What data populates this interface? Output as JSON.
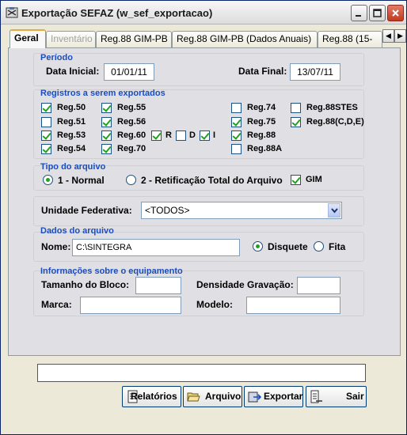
{
  "window": {
    "title": "Exportação SEFAZ (w_sef_exportacao)"
  },
  "tabs": [
    {
      "label": "Geral",
      "state": "active"
    },
    {
      "label": "Inventário",
      "state": "disabled"
    },
    {
      "label": "Reg.88 GIM-PB",
      "state": "normal"
    },
    {
      "label": "Reg.88 GIM-PB (Dados Anuais)",
      "state": "normal"
    },
    {
      "label": "Reg.88 (15-",
      "state": "normal"
    }
  ],
  "tab_arrows": {
    "left": "◀",
    "right": "▶"
  },
  "periodo": {
    "title": "Período",
    "data_inicial_label": "Data Inicial:",
    "data_inicial_value": "01/01/11",
    "data_final_label": "Data Final:",
    "data_final_value": "13/07/11"
  },
  "registros": {
    "title": "Registros a serem exportados",
    "items": [
      {
        "label": "Reg.50",
        "checked": true
      },
      {
        "label": "Reg.55",
        "checked": true
      },
      {
        "label": "Reg.74",
        "checked": false
      },
      {
        "label": "Reg.88STES",
        "checked": false
      },
      {
        "label": "Reg.51",
        "checked": false
      },
      {
        "label": "Reg.56",
        "checked": true
      },
      {
        "label": "Reg.75",
        "checked": true
      },
      {
        "label": "Reg.88(C,D,E)",
        "checked": true
      },
      {
        "label": "Reg.53",
        "checked": true
      },
      {
        "label": "Reg.60",
        "checked": true
      },
      {
        "label": "R",
        "checked": true
      },
      {
        "label": "D",
        "checked": false
      },
      {
        "label": "I",
        "checked": true
      },
      {
        "label": "Reg.88",
        "checked": true
      },
      {
        "label": "Reg.54",
        "checked": true
      },
      {
        "label": "Reg.70",
        "checked": true
      },
      {
        "label": "Reg.88A",
        "checked": false
      }
    ]
  },
  "tipo_arquivo": {
    "title": "Tipo do arquivo",
    "option1": "1 - Normal",
    "option1_selected": true,
    "option2": "2 - Retificação Total do Arquivo",
    "option2_selected": false,
    "gim_label": "GIM",
    "gim_checked": true
  },
  "unidade_federativa": {
    "label": "Unidade Federativa:",
    "value": "<TODOS>"
  },
  "dados_arquivo": {
    "title": "Dados do arquivo",
    "nome_label": "Nome:",
    "nome_value": "C:\\SINTEGRA",
    "disquete_label": "Disquete",
    "disquete_selected": true,
    "fita_label": "Fita",
    "fita_selected": false
  },
  "equipamento": {
    "title": "Informações sobre o equipamento",
    "tamanho_label": "Tamanho do Bloco:",
    "tamanho_value": "",
    "densidade_label": "Densidade Gravação:",
    "densidade_value": "",
    "marca_label": "Marca:",
    "marca_value": "",
    "modelo_label": "Modelo:",
    "modelo_value": ""
  },
  "buttons": {
    "relatorios": "Relatórios",
    "arquivo": "Arquivo",
    "exportar": "Exportar",
    "sair": "Sair"
  },
  "icons": {
    "app": "app-icon",
    "relatorios": "report-icon",
    "arquivo": "folder-open-icon",
    "exportar": "export-icon",
    "sair": "exit-icon"
  },
  "colors": {
    "group_title": "#1a4dbf",
    "checkmark": "#21a121",
    "panel_bg": "#e0dfe3"
  }
}
